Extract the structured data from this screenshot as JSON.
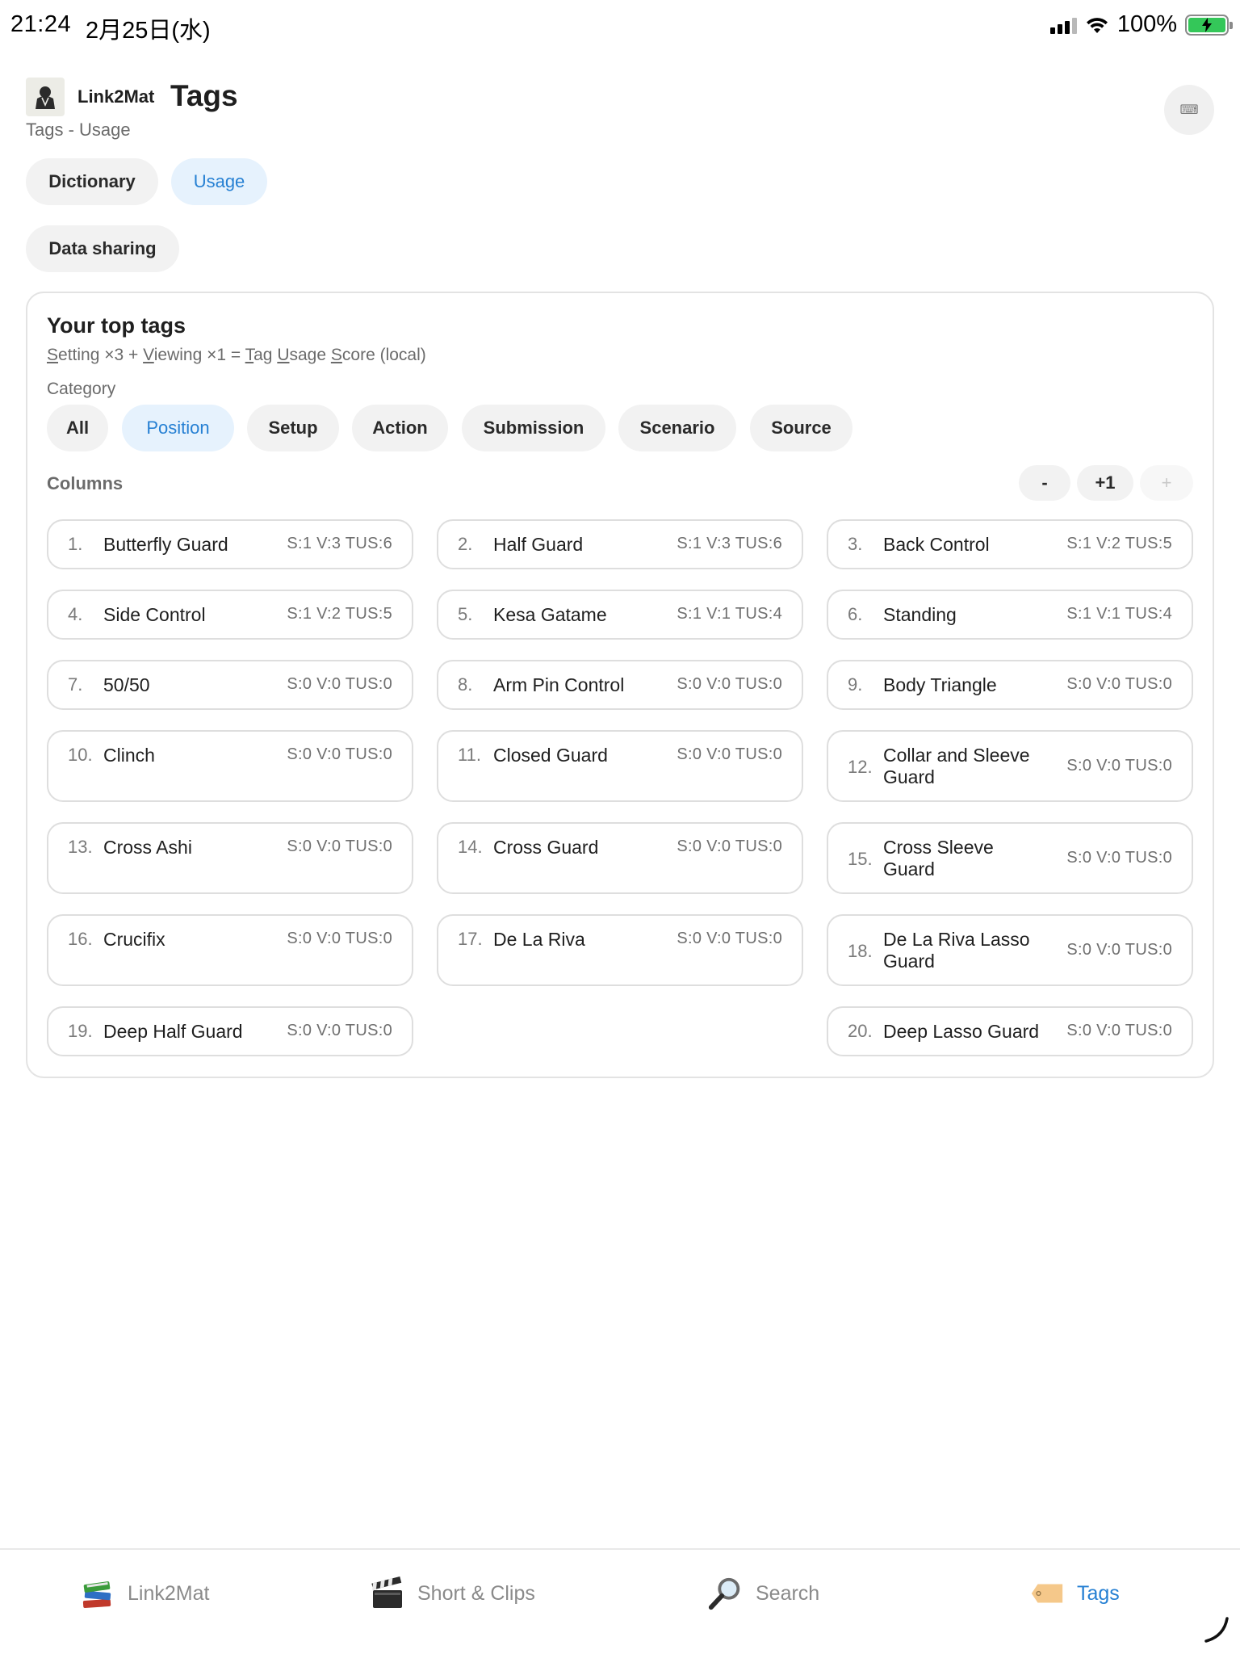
{
  "status_bar": {
    "time": "21:24",
    "date": "2月25日(水)",
    "battery": "100%"
  },
  "header": {
    "app_name": "Link2Mat",
    "title": "Tags",
    "breadcrumb": "Tags - Usage",
    "keyboard_button": "⌨"
  },
  "tabs": [
    {
      "label": "Dictionary",
      "active": false
    },
    {
      "label": "Usage",
      "active": true
    },
    {
      "label": "Data sharing",
      "active": false
    }
  ],
  "card": {
    "title": "Your top tags",
    "subtitle": "Setting ×3 + Viewing ×1 = Tag Usage Score (local)",
    "category_label": "Category",
    "categories": [
      {
        "label": "All",
        "active": false
      },
      {
        "label": "Position",
        "active": true
      },
      {
        "label": "Setup",
        "active": false
      },
      {
        "label": "Action",
        "active": false
      },
      {
        "label": "Submission",
        "active": false
      },
      {
        "label": "Scenario",
        "active": false
      },
      {
        "label": "Source",
        "active": false
      }
    ],
    "columns_label": "Columns",
    "column_buttons": {
      "minus": "-",
      "plus_one": "+1",
      "plus": "+"
    },
    "tags": [
      {
        "rank": "1.",
        "name": "Butterfly Guard",
        "stats": "S:1 V:3 TUS:6"
      },
      {
        "rank": "2.",
        "name": "Half Guard",
        "stats": "S:1 V:3 TUS:6"
      },
      {
        "rank": "3.",
        "name": "Back Control",
        "stats": "S:1 V:2 TUS:5"
      },
      {
        "rank": "4.",
        "name": "Side Control",
        "stats": "S:1 V:2 TUS:5"
      },
      {
        "rank": "5.",
        "name": "Kesa Gatame",
        "stats": "S:1 V:1 TUS:4"
      },
      {
        "rank": "6.",
        "name": "Standing",
        "stats": "S:1 V:1 TUS:4"
      },
      {
        "rank": "7.",
        "name": "50/50",
        "stats": "S:0 V:0 TUS:0"
      },
      {
        "rank": "8.",
        "name": "Arm Pin Control",
        "stats": "S:0 V:0 TUS:0"
      },
      {
        "rank": "9.",
        "name": "Body Triangle",
        "stats": "S:0 V:0 TUS:0"
      },
      {
        "rank": "10.",
        "name": "Clinch",
        "stats": "S:0 V:0 TUS:0"
      },
      {
        "rank": "11.",
        "name": "Closed Guard",
        "stats": "S:0 V:0 TUS:0"
      },
      {
        "rank": "12.",
        "name": "Collar and Sleeve Guard",
        "stats": "S:0 V:0 TUS:0"
      },
      {
        "rank": "13.",
        "name": "Cross Ashi",
        "stats": "S:0 V:0 TUS:0"
      },
      {
        "rank": "14.",
        "name": "Cross Guard",
        "stats": "S:0 V:0 TUS:0"
      },
      {
        "rank": "15.",
        "name": "Cross Sleeve Guard",
        "stats": "S:0 V:0 TUS:0"
      },
      {
        "rank": "16.",
        "name": "Crucifix",
        "stats": "S:0 V:0 TUS:0"
      },
      {
        "rank": "17.",
        "name": "De La Riva",
        "stats": "S:0 V:0 TUS:0"
      },
      {
        "rank": "18.",
        "name": "De La Riva Lasso Guard",
        "stats": "S:0 V:0 TUS:0"
      },
      {
        "rank": "19.",
        "name": "Deep Half Guard",
        "stats": "S:0 V:0 TUS:0"
      },
      {
        "rank": "20.",
        "name": "Deep Lasso Guard",
        "stats": "S:0 V:0 TUS:0"
      }
    ]
  },
  "tab_bar": [
    {
      "label": "Link2Mat",
      "icon": "books-icon",
      "active": false
    },
    {
      "label": "Short & Clips",
      "icon": "clapperboard-icon",
      "active": false
    },
    {
      "label": "Search",
      "icon": "magnifier-icon",
      "active": false
    },
    {
      "label": "Tags",
      "icon": "tag-icon",
      "active": true
    }
  ],
  "colors": {
    "accent": "#2680d3",
    "active_bg": "#e6f2fd",
    "chip_bg": "#f2f2f2",
    "battery": "#34c759"
  }
}
